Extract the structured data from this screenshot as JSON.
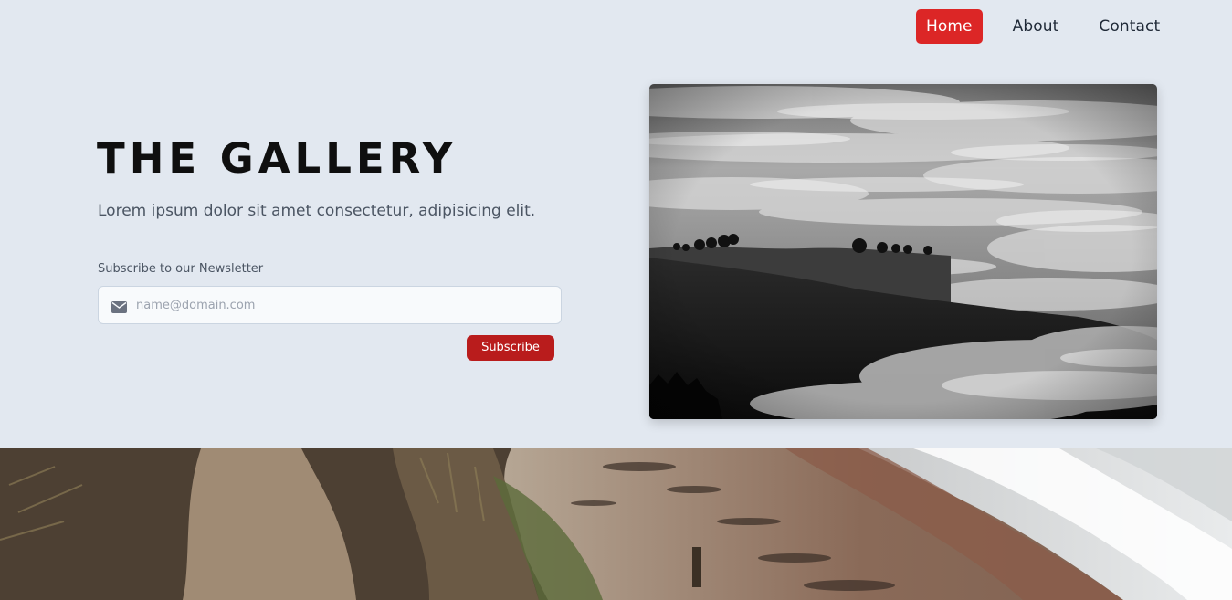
{
  "nav": {
    "items": [
      {
        "label": "Home",
        "active": true
      },
      {
        "label": "About",
        "active": false
      },
      {
        "label": "Contact",
        "active": false
      }
    ]
  },
  "hero": {
    "title": "THE GALLERY",
    "subtitle": "Lorem ipsum dolor sit amet consectetur, adipisicing elit."
  },
  "newsletter": {
    "label": "Subscribe to our Newsletter",
    "email_placeholder": "name@domain.com",
    "email_value": "",
    "icon": "mail-icon",
    "button_label": "Subscribe"
  },
  "images": {
    "hero": "foggy-hills-photo",
    "banner": "beach-coast-photo"
  },
  "colors": {
    "background": "#e2e8f0",
    "accent": "#dc2626",
    "button": "#b91c1c"
  }
}
